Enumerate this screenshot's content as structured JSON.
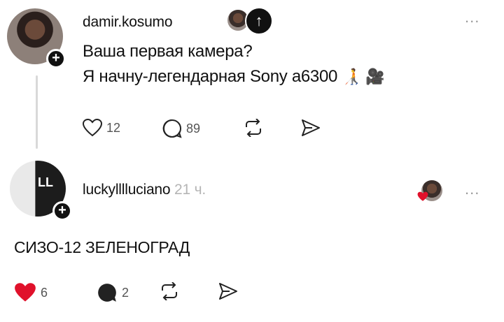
{
  "post": {
    "username": "damir.kosumo",
    "line1": "Ваша первая камера?",
    "line2": "Я начну-легендарная Sony a6300",
    "emoji1": "🧑‍🦯",
    "emoji2": "🎥",
    "avatar_badge": "+",
    "follow_badge": "↑",
    "more_label": "...",
    "like_count": "12",
    "comment_count": "89"
  },
  "reply": {
    "username": "luckylllluciano",
    "time": "21 ч.",
    "avatar_letters": "LL",
    "avatar_badge": "+",
    "more_label": "...",
    "text": "СИЗО-12 ЗЕЛЕНОГРАД",
    "like_count": "6",
    "comment_count": "2"
  },
  "colors": {
    "heart_red": "#e0112b",
    "text": "#111111",
    "muted": "#b5b5b5"
  },
  "icons": [
    "heart-icon",
    "comment-icon",
    "repost-icon",
    "share-icon",
    "more-icon",
    "arrow-up-icon",
    "plus-icon"
  ]
}
